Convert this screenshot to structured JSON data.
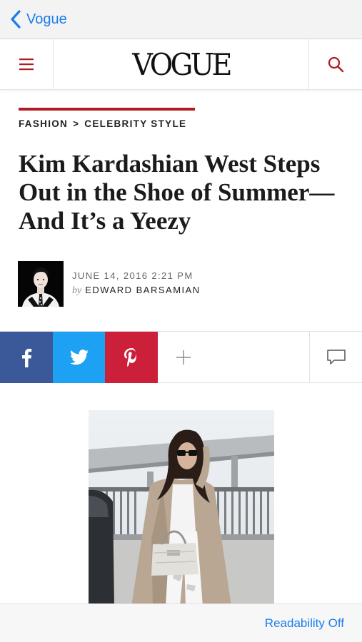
{
  "nav": {
    "back_label": "Vogue"
  },
  "header": {
    "logo": "VOGUE"
  },
  "breadcrumb": {
    "section": "FASHION",
    "separator": ">",
    "subsection": "CELEBRITY STYLE"
  },
  "article": {
    "headline_lines": [
      "Kim Kardashian West Steps",
      "Out in the Shoe of Summer—",
      "And It’s a Yeezy"
    ],
    "date": "JUNE 14, 2016 2:21 PM",
    "by": "by",
    "author": "EDWARD BARSAMIAN"
  },
  "share": {
    "icons": [
      "facebook-icon",
      "twitter-icon",
      "pinterest-icon",
      "plus-icon",
      "comment-icon"
    ]
  },
  "footer": {
    "readability_label": "Readability Off"
  },
  "colors": {
    "accent_blue": "#1a7cf0",
    "vogue_red": "#b01c22",
    "facebook": "#3b5998",
    "twitter": "#1da1f2",
    "pinterest": "#cb1f3a"
  }
}
